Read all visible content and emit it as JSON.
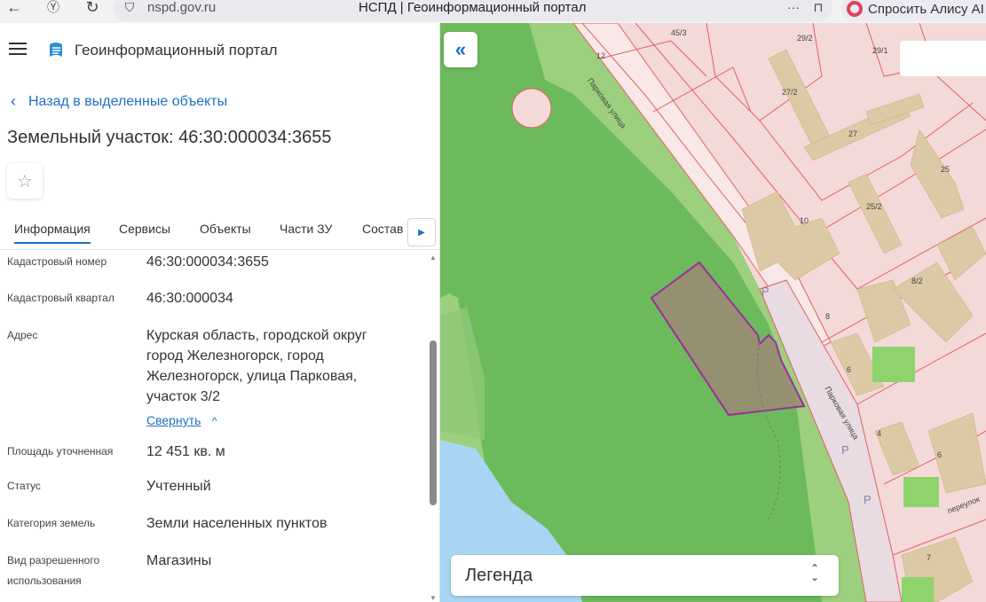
{
  "browser": {
    "url": "nspd.gov.ru",
    "tab_title": "НСПД | Геоинформационный портал",
    "alice_label": "Спросить Алису AI"
  },
  "header": {
    "app_title": "Геоинформационный портал"
  },
  "nav": {
    "back_label": "Назад в выделенные объекты"
  },
  "object": {
    "title": "Земельный участок: 46:30:000034:3655"
  },
  "tabs": [
    {
      "label": "Информация",
      "active": true
    },
    {
      "label": "Сервисы"
    },
    {
      "label": "Объекты"
    },
    {
      "label": "Части ЗУ"
    },
    {
      "label": "Состав"
    }
  ],
  "fields": {
    "cadastral_number": {
      "label": "Кадастровый номер",
      "value": "46:30:000034:3655"
    },
    "cadastral_quarter": {
      "label": "Кадастровый квартал",
      "value": "46:30:000034"
    },
    "address": {
      "label": "Адрес",
      "value": "Курская область, городской округ город Железногорск, город Железногорск, улица Парковая, участок 3/2",
      "collapse_label": "Свернуть"
    },
    "area": {
      "label": "Площадь уточненная",
      "value": "12 451 кв. м"
    },
    "status": {
      "label": "Статус",
      "value": "Учтенный"
    },
    "land_category": {
      "label": "Категория земель",
      "value": "Земли населенных пунктов"
    },
    "permitted_use": {
      "label": "Вид разрешенного использования",
      "value": "Магазины"
    }
  },
  "map": {
    "legend_label": "Легенда",
    "street_labels": [
      "Парковая улица",
      "Парковая улица",
      "переулок"
    ],
    "building_numbers": [
      "12",
      "45/3",
      "29/2",
      "29/1",
      "27/2",
      "27",
      "25",
      "25/2",
      "10",
      "8/2",
      "8",
      "6",
      "4",
      "6",
      "7"
    ],
    "parking_labels": [
      "P",
      "P",
      "P"
    ],
    "colors": {
      "background": "#f4d9d9",
      "park": "#6dba5c",
      "park_light": "#9ccf7e",
      "water": "#a9d6f4",
      "parcel_fill": "#9a8c74",
      "parcel_outline": "#9b2f9b",
      "lines": "#e06060",
      "buildings": "#dcc9a6"
    }
  }
}
